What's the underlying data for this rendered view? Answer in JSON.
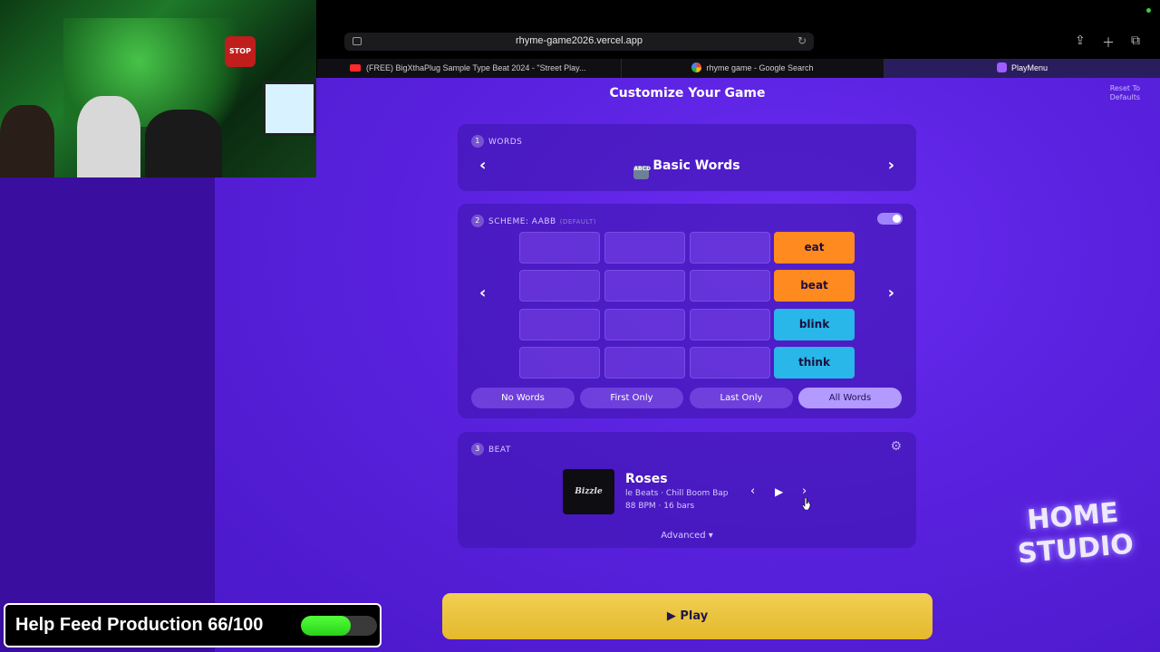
{
  "browser": {
    "url": "rhyme-game2026.vercel.app",
    "tabs": [
      {
        "label": "(FREE) BigXthaPlug Sample Type Beat 2024 - \"Street Play..."
      },
      {
        "label": "rhyme game - Google Search"
      },
      {
        "label": "PlayMenu"
      }
    ]
  },
  "page": {
    "title": "Customize Your Game",
    "reset_label": "Reset To Defaults"
  },
  "words": {
    "number": "1",
    "label": "WORDS",
    "title": "Basic Words",
    "icon_text": "ABCD"
  },
  "scheme": {
    "number": "2",
    "label": "SCHEME: AABB",
    "sublabel": "(DEFAULT)",
    "enabled": true,
    "rhyme_words": [
      {
        "text": "eat",
        "color": "#ff8a1f"
      },
      {
        "text": "beat",
        "color": "#ff8a1f"
      },
      {
        "text": "blink",
        "color": "#29b6e8"
      },
      {
        "text": "think",
        "color": "#29b6e8"
      }
    ],
    "options": [
      "No Words",
      "First Only",
      "Last Only",
      "All Words"
    ],
    "selected_option": "All Words"
  },
  "beat": {
    "number": "3",
    "label": "BEAT",
    "album_text": "Bizzle",
    "title": "Roses",
    "artist_genre": "le Beats · Chill Boom Bap",
    "bpm_bars": "88 BPM · 16 bars",
    "advanced_label": "Advanced ▾"
  },
  "play_label": "Play",
  "overlay": {
    "webcam_sign": "STOP",
    "feed_text": "Help Feed Production 66/100",
    "feed_progress": 0.66,
    "logo_text": "HOME STUDIO"
  },
  "colors": {
    "accent": "#6a2cf2",
    "play": "#e9c23c",
    "toggle": "#a084ff"
  }
}
